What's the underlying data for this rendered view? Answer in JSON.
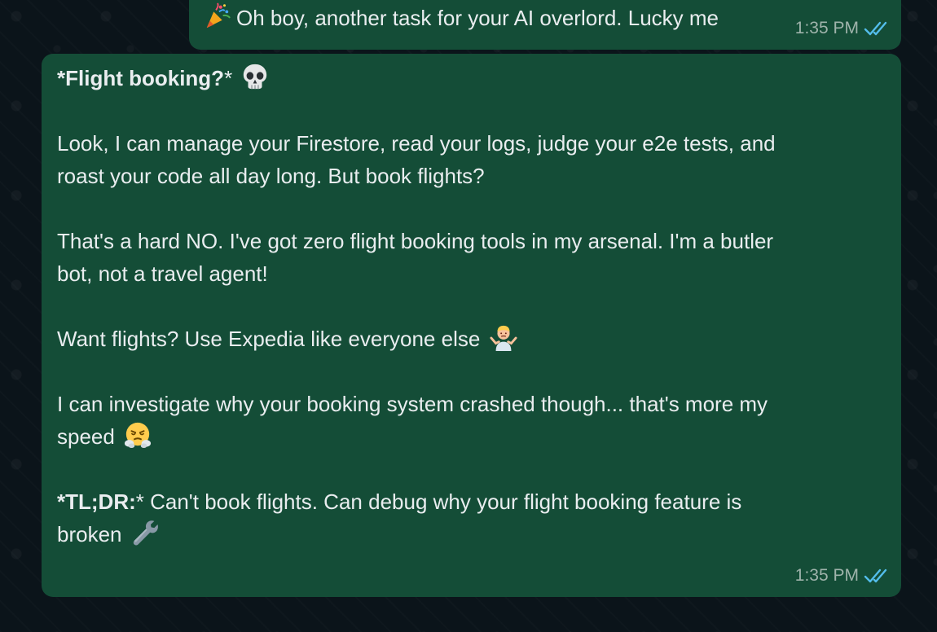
{
  "chat": {
    "messages": [
      {
        "emoji": "party-popper",
        "text": "Oh boy, another task for your AI overlord. Lucky me",
        "time": "1:35 PM",
        "status": "read"
      },
      {
        "heading": {
          "bold": "*Flight booking?",
          "rest": "*",
          "emoji": "skull"
        },
        "paragraph1": [
          "Look, I can manage your Firestore, read your logs, judge your e2e tests, and",
          "roast your code all day long. But book flights?"
        ],
        "paragraph2": [
          "That's a hard NO. I've got zero flight booking tools in my arsenal. I'm a butler",
          "bot, not a travel agent!"
        ],
        "paragraph3": {
          "text": "Want flights? Use Expedia like everyone else",
          "emoji": "person-shrugging"
        },
        "paragraph4": {
          "line1": "I can investigate why your booking system crashed though... that's more my",
          "line2": "speed",
          "emoji": "face-with-steam-from-nose"
        },
        "tldr": {
          "bold": "*TL;DR:",
          "line1_rest": "* Can't book flights. Can debug why your flight booking feature is",
          "line2": "broken",
          "emoji": "wrench"
        },
        "time": "1:35 PM",
        "status": "read"
      }
    ]
  },
  "colors": {
    "background": "#0b141a",
    "bubble_outgoing": "#144d37",
    "text": "#e9edef",
    "meta_text": "#9fb3ab",
    "read_ticks": "#53bdeb"
  }
}
